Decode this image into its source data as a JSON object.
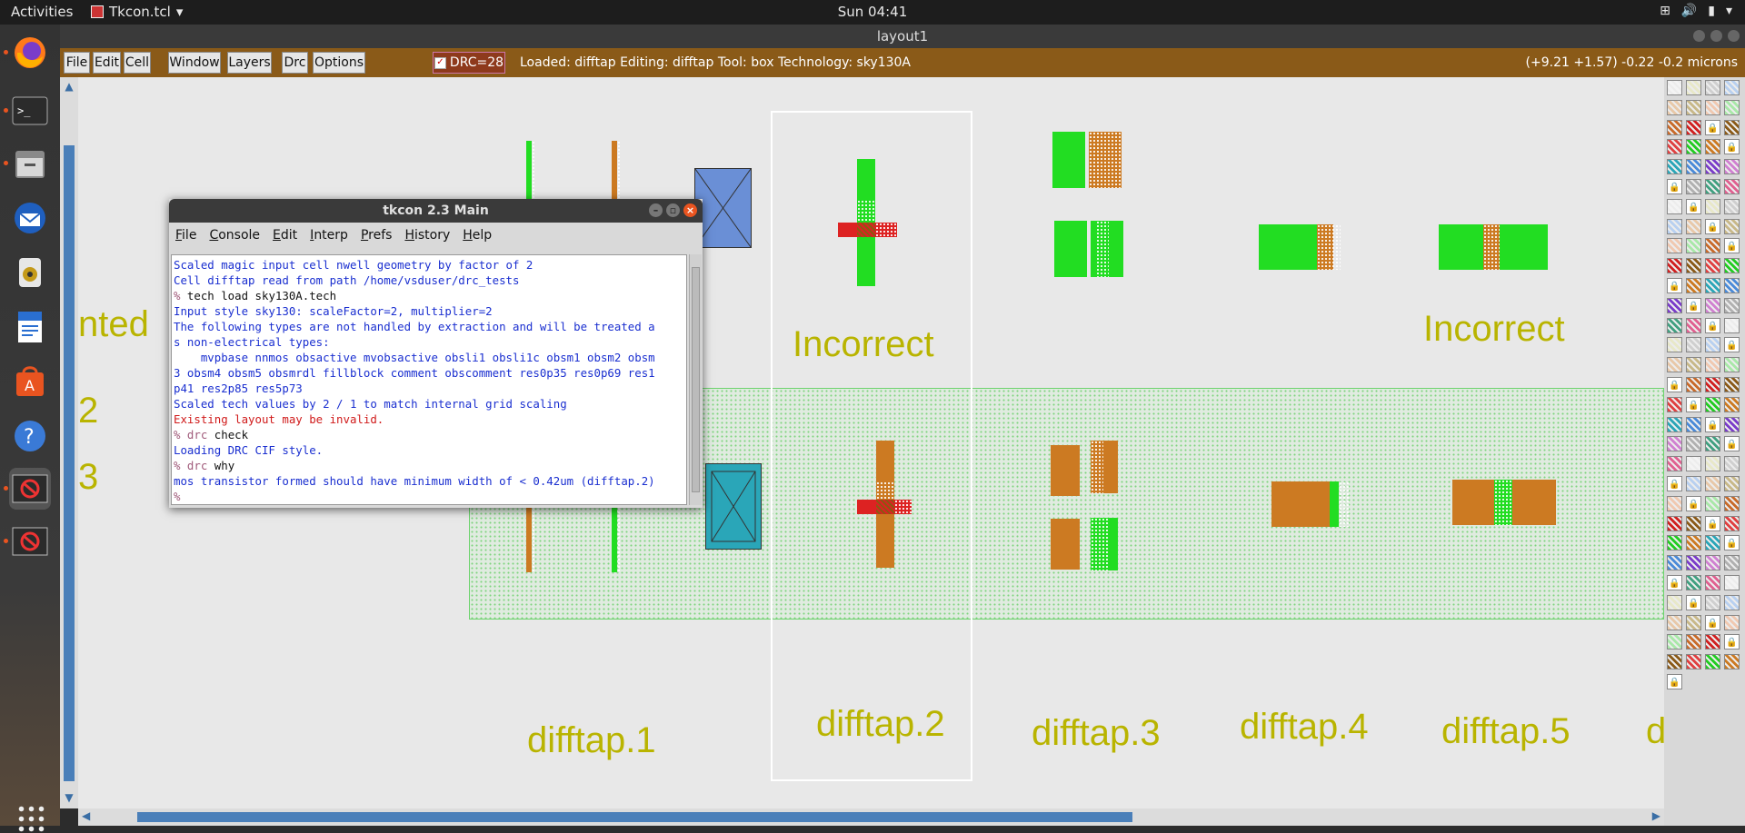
{
  "topbar": {
    "activities": "Activities",
    "app_name": "Tkcon.tcl",
    "app_arrow": "▾",
    "clock": "Sun 04:41"
  },
  "magic": {
    "window_title": "layout1",
    "menu": [
      "File",
      "Edit",
      "Cell",
      "Window",
      "Layers",
      "Drc",
      "Options"
    ],
    "drc_label": "DRC=28",
    "status": "Loaded: difftap Editing: difftap Tool: box  Technology: sky130A",
    "coords": "(+9.21 +1.57) -0.22 -0.2 microns"
  },
  "canvas": {
    "labels": {
      "incorrect_1": "Incorrect",
      "incorrect_2": "Incorrect",
      "partial_nted": "nted",
      "partial_2": "2",
      "partial_3": "3",
      "difftap_1": "difftap.1",
      "difftap_2": "difftap.2",
      "difftap_3": "difftap.3",
      "difftap_4": "difftap.4",
      "difftap_5": "difftap.5",
      "partial_d": "d"
    }
  },
  "tkcon": {
    "title": "tkcon 2.3 Main",
    "menu": [
      "File",
      "Console",
      "Edit",
      "Interp",
      "Prefs",
      "History",
      "Help"
    ],
    "lines": [
      {
        "kind": "out",
        "text": "Scaled magic input cell nwell geometry by factor of 2"
      },
      {
        "kind": "out",
        "text": "Cell difftap read from path /home/vsduser/drc_tests"
      },
      {
        "kind": "cmd",
        "prompt": "%",
        "text": " tech load sky130A.tech"
      },
      {
        "kind": "out",
        "text": "Input style sky130: scaleFactor=2, multiplier=2"
      },
      {
        "kind": "out",
        "text": "The following types are not handled by extraction and will be treated a"
      },
      {
        "kind": "out",
        "text": "s non-electrical types:"
      },
      {
        "kind": "out",
        "text": "    mvpbase nnmos obsactive mvobsactive obsli1 obsli1c obsm1 obsm2 obsm"
      },
      {
        "kind": "out",
        "text": "3 obsm4 obsm5 obsmrdl fillblock comment obscomment res0p35 res0p69 res1"
      },
      {
        "kind": "out",
        "text": "p41 res2p85 res5p73"
      },
      {
        "kind": "out",
        "text": "Scaled tech values by 2 / 1 to match internal grid scaling"
      },
      {
        "kind": "err",
        "text": "Existing layout may be invalid."
      },
      {
        "kind": "cmd",
        "prompt": "% drc",
        "text": " check"
      },
      {
        "kind": "out",
        "text": "Loading DRC CIF style."
      },
      {
        "kind": "cmd",
        "prompt": "% drc",
        "text": " why"
      },
      {
        "kind": "out",
        "text": "mos transistor formed should have minimum width of < 0.42um (difftap.2)"
      },
      {
        "kind": "cmd",
        "prompt": "%",
        "text": ""
      }
    ]
  },
  "colors": {
    "accent": "#8a5a18",
    "label": "#b9b400",
    "diffusion": "#22dd22",
    "ndiff": "#cc7a22",
    "poly": "#dd2222"
  },
  "icons": [
    "firefox-icon",
    "terminal-icon",
    "files-icon",
    "thunderbird-icon",
    "rhythmbox-icon",
    "writer-icon",
    "software-icon",
    "help-icon",
    "tk-icon",
    "tk-icon-2"
  ]
}
